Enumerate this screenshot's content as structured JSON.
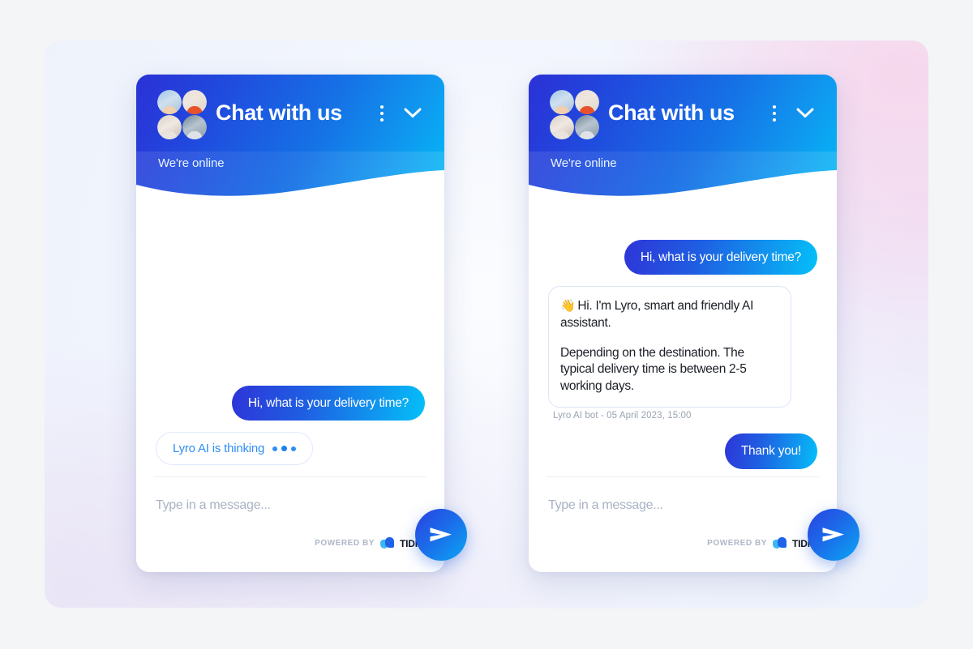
{
  "theme": {
    "page_background": "#f4f5f7",
    "brand_blue": "#1f63e8",
    "brand_cyan": "#00bdf7",
    "brand_indigo": "#2b31d6",
    "bot_bubble_border": "#dce4f7",
    "thinking_text_color": "#2f8ef5",
    "placeholder_color": "#a9b2c4",
    "meta_text_color": "#9aa3b2"
  },
  "widgets": [
    {
      "id": "thinking",
      "header": {
        "title": "Chat with us",
        "status": "We're online",
        "kebab_icon": "kebab-menu-icon",
        "collapse_icon": "chevron-down-icon",
        "avatars": [
          "agent-avatar-1",
          "agent-avatar-2",
          "agent-avatar-3",
          "agent-avatar-4"
        ]
      },
      "messages": [
        {
          "role": "user",
          "text": "Hi, what is your delivery time?"
        }
      ],
      "thinking": {
        "label": "Lyro AI is thinking",
        "dots": 3
      },
      "footer": {
        "placeholder": "Type in a message...",
        "powered_by_label": "POWERED BY",
        "brand_name": "TIDIO",
        "send_icon": "send-paper-plane-icon"
      }
    },
    {
      "id": "answered",
      "header": {
        "title": "Chat with us",
        "status": "We're online",
        "kebab_icon": "kebab-menu-icon",
        "collapse_icon": "chevron-down-icon",
        "avatars": [
          "agent-avatar-1",
          "agent-avatar-2",
          "agent-avatar-3",
          "agent-avatar-4"
        ]
      },
      "messages": [
        {
          "role": "user",
          "text": "Hi, what is your delivery time?"
        },
        {
          "role": "bot",
          "emoji": "👋",
          "paragraph_1": "Hi. I'm Lyro, smart and friendly AI assistant.",
          "paragraph_2": "Depending on the destination. The typical delivery time is between 2-5 working days.",
          "meta": "Lyro AI bot - 05 April 2023, 15:00"
        },
        {
          "role": "user",
          "text": "Thank you!"
        }
      ],
      "footer": {
        "placeholder": "Type in a message...",
        "powered_by_label": "POWERED BY",
        "brand_name": "TIDIO",
        "send_icon": "send-paper-plane-icon"
      }
    }
  ]
}
